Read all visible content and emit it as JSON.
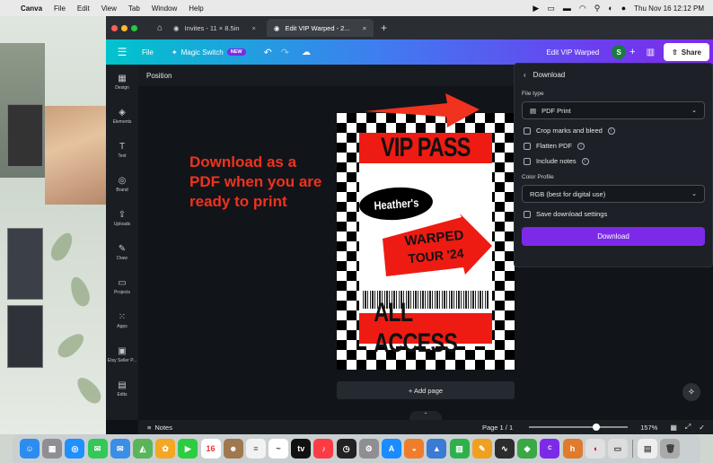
{
  "menubar": {
    "app": "Canva",
    "items": [
      "File",
      "Edit",
      "View",
      "Tab",
      "Window",
      "Help"
    ],
    "clock": "Thu Nov 16  12:12 PM"
  },
  "browser": {
    "tabs": [
      {
        "label": "Invites - 11 × 8.5in",
        "active": false
      },
      {
        "label": "Edit VIP Warped - 2...",
        "active": true
      }
    ]
  },
  "toolbar": {
    "file": "File",
    "magic_switch": "Magic Switch",
    "new_badge": "NEW",
    "doc_title": "Edit VIP Warped",
    "avatar": "S",
    "share": "Share"
  },
  "sidebar": [
    {
      "label": "Design",
      "icon": "▦"
    },
    {
      "label": "Elements",
      "icon": "◈"
    },
    {
      "label": "Text",
      "icon": "T"
    },
    {
      "label": "Brand",
      "icon": "◎"
    },
    {
      "label": "Uploads",
      "icon": "⇪"
    },
    {
      "label": "Draw",
      "icon": "✎"
    },
    {
      "label": "Projects",
      "icon": "▭"
    },
    {
      "label": "Apps",
      "icon": "⁙"
    },
    {
      "label": "Etsy Seller P...",
      "icon": "▣"
    },
    {
      "label": "Edits",
      "icon": "▤"
    }
  ],
  "position_label": "Position",
  "callout": "Download as a PDF when you are ready to print",
  "design": {
    "top_text": "VIP PASS",
    "name": "Heather's",
    "event_line1": "WARPED",
    "event_line2": "TOUR '24",
    "bottom_text": "ALL ACCESS",
    "accent": "#ee1b13"
  },
  "add_page": "+ Add page",
  "download_panel": {
    "title": "Download",
    "file_type_label": "File type",
    "file_type_value": "PDF Print",
    "options": [
      {
        "label": "Crop marks and bleed",
        "info": true
      },
      {
        "label": "Flatten PDF",
        "info": true
      },
      {
        "label": "Include notes",
        "info": true
      }
    ],
    "color_profile_label": "Color Profile",
    "color_profile_value": "RGB (best for digital use)",
    "save_settings": "Save download settings",
    "button": "Download",
    "button_color": "#7d2ae8"
  },
  "status": {
    "notes": "Notes",
    "page": "Page 1 / 1",
    "zoom": "157%",
    "zoom_slider_fraction": 0.68
  }
}
